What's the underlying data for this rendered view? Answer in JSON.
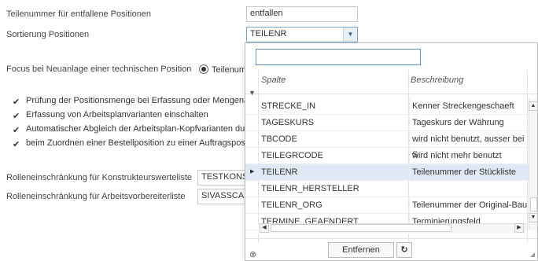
{
  "form": {
    "row1_label": "Teilenummer für entfallene Positionen",
    "row1_value": "entfallen",
    "row2_label": "Sortierung Positionen",
    "row2_value": "TEILENR",
    "focus_label": "Focus bei Neuanlage einer technischen Position",
    "focus_option": "Teilenumr",
    "checkboxes": [
      "Prüfung der Positionsmenge bei Erfassung oder Mengenä",
      "Erfassung von Arbeitsplanvarianten einschalten",
      "Automatischer Abgleich der Arbeitsplan-Kopfvarianten du",
      "beim Zuordnen einer Bestellposition zu einer Auftragspos"
    ],
    "role1_label": "Rolleneinschränkung für Konstrukteurswerteliste",
    "role1_value": "TESTKONST",
    "role2_label": "Rolleneinschränkung für Arbeitsvorbereiterliste",
    "role2_value": "SIVASSCANN"
  },
  "popup": {
    "search_value": "",
    "col_spalte": "Spalte",
    "col_beschreibung": "Beschreibung",
    "rows": [
      {
        "spalte": "STRECKE_IN",
        "beschreibung": "Kenner Streckengeschaeft"
      },
      {
        "spalte": "TAGESKURS",
        "beschreibung": "Tageskurs der Währung"
      },
      {
        "spalte": "TBCODE",
        "beschreibung": "wird nicht benutzt, ausser bei S"
      },
      {
        "spalte": "TEILEGRCODE",
        "beschreibung": "wird nicht mehr benutzt"
      },
      {
        "spalte": "TEILENR",
        "beschreibung": "Teilenummer der Stückliste"
      },
      {
        "spalte": "TEILENR_HERSTELLER",
        "beschreibung": ""
      },
      {
        "spalte": "TEILENR_ORG",
        "beschreibung": "Teilenummer der Original-Bau"
      },
      {
        "spalte": "TERMINE_GEAENDERT",
        "beschreibung": "Terminierungsfeld"
      }
    ],
    "selected_index": 4,
    "remove_label": "Entfernen"
  }
}
